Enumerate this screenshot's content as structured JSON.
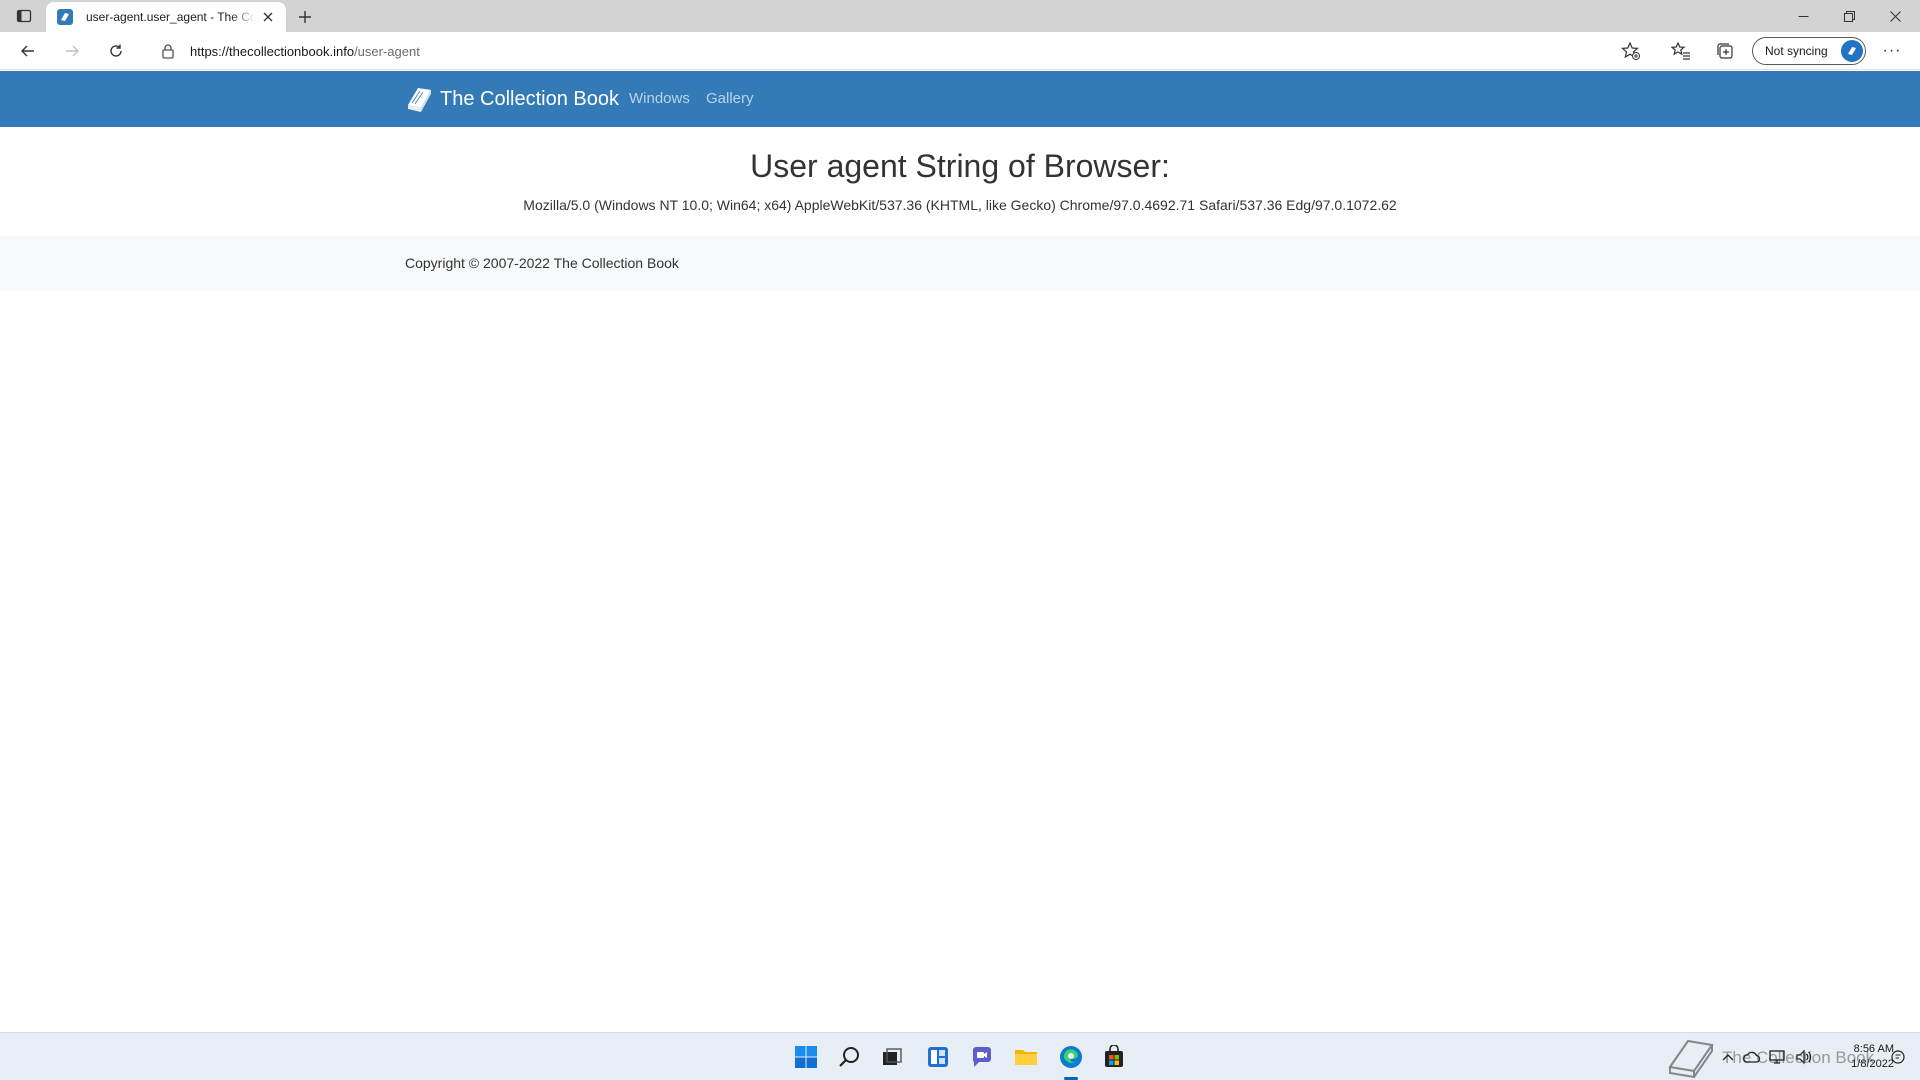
{
  "browser": {
    "tab": {
      "title": "user-agent.user_agent - The Collection Book"
    },
    "url": {
      "host": "https://thecollectionbook.info",
      "path": "/user-agent"
    },
    "sync_label": "Not syncing"
  },
  "site": {
    "brand": "The Collection Book",
    "nav": [
      "Windows",
      "Gallery"
    ],
    "heading": "User agent String of Browser:",
    "user_agent": "Mozilla/5.0 (Windows NT 10.0; Win64; x64) AppleWebKit/537.36 (KHTML, like Gecko) Chrome/97.0.4692.71 Safari/537.36 Edg/97.0.1072.62",
    "footer": "Copyright © 2007-2022 The Collection Book"
  },
  "taskbar": {
    "apps": [
      "start-icon",
      "search-icon",
      "task-view-icon",
      "widgets-icon",
      "chat-icon",
      "file-explorer-icon",
      "edge-icon",
      "store-icon"
    ],
    "time": "8:56 AM",
    "date": "1/8/2022",
    "watermark": "The Collection Book"
  },
  "colors": {
    "navbar": "#337ab7",
    "footer": "#f8f9fa",
    "tabstrip": "#d3d3d3",
    "taskbar": "#e7eef6"
  }
}
